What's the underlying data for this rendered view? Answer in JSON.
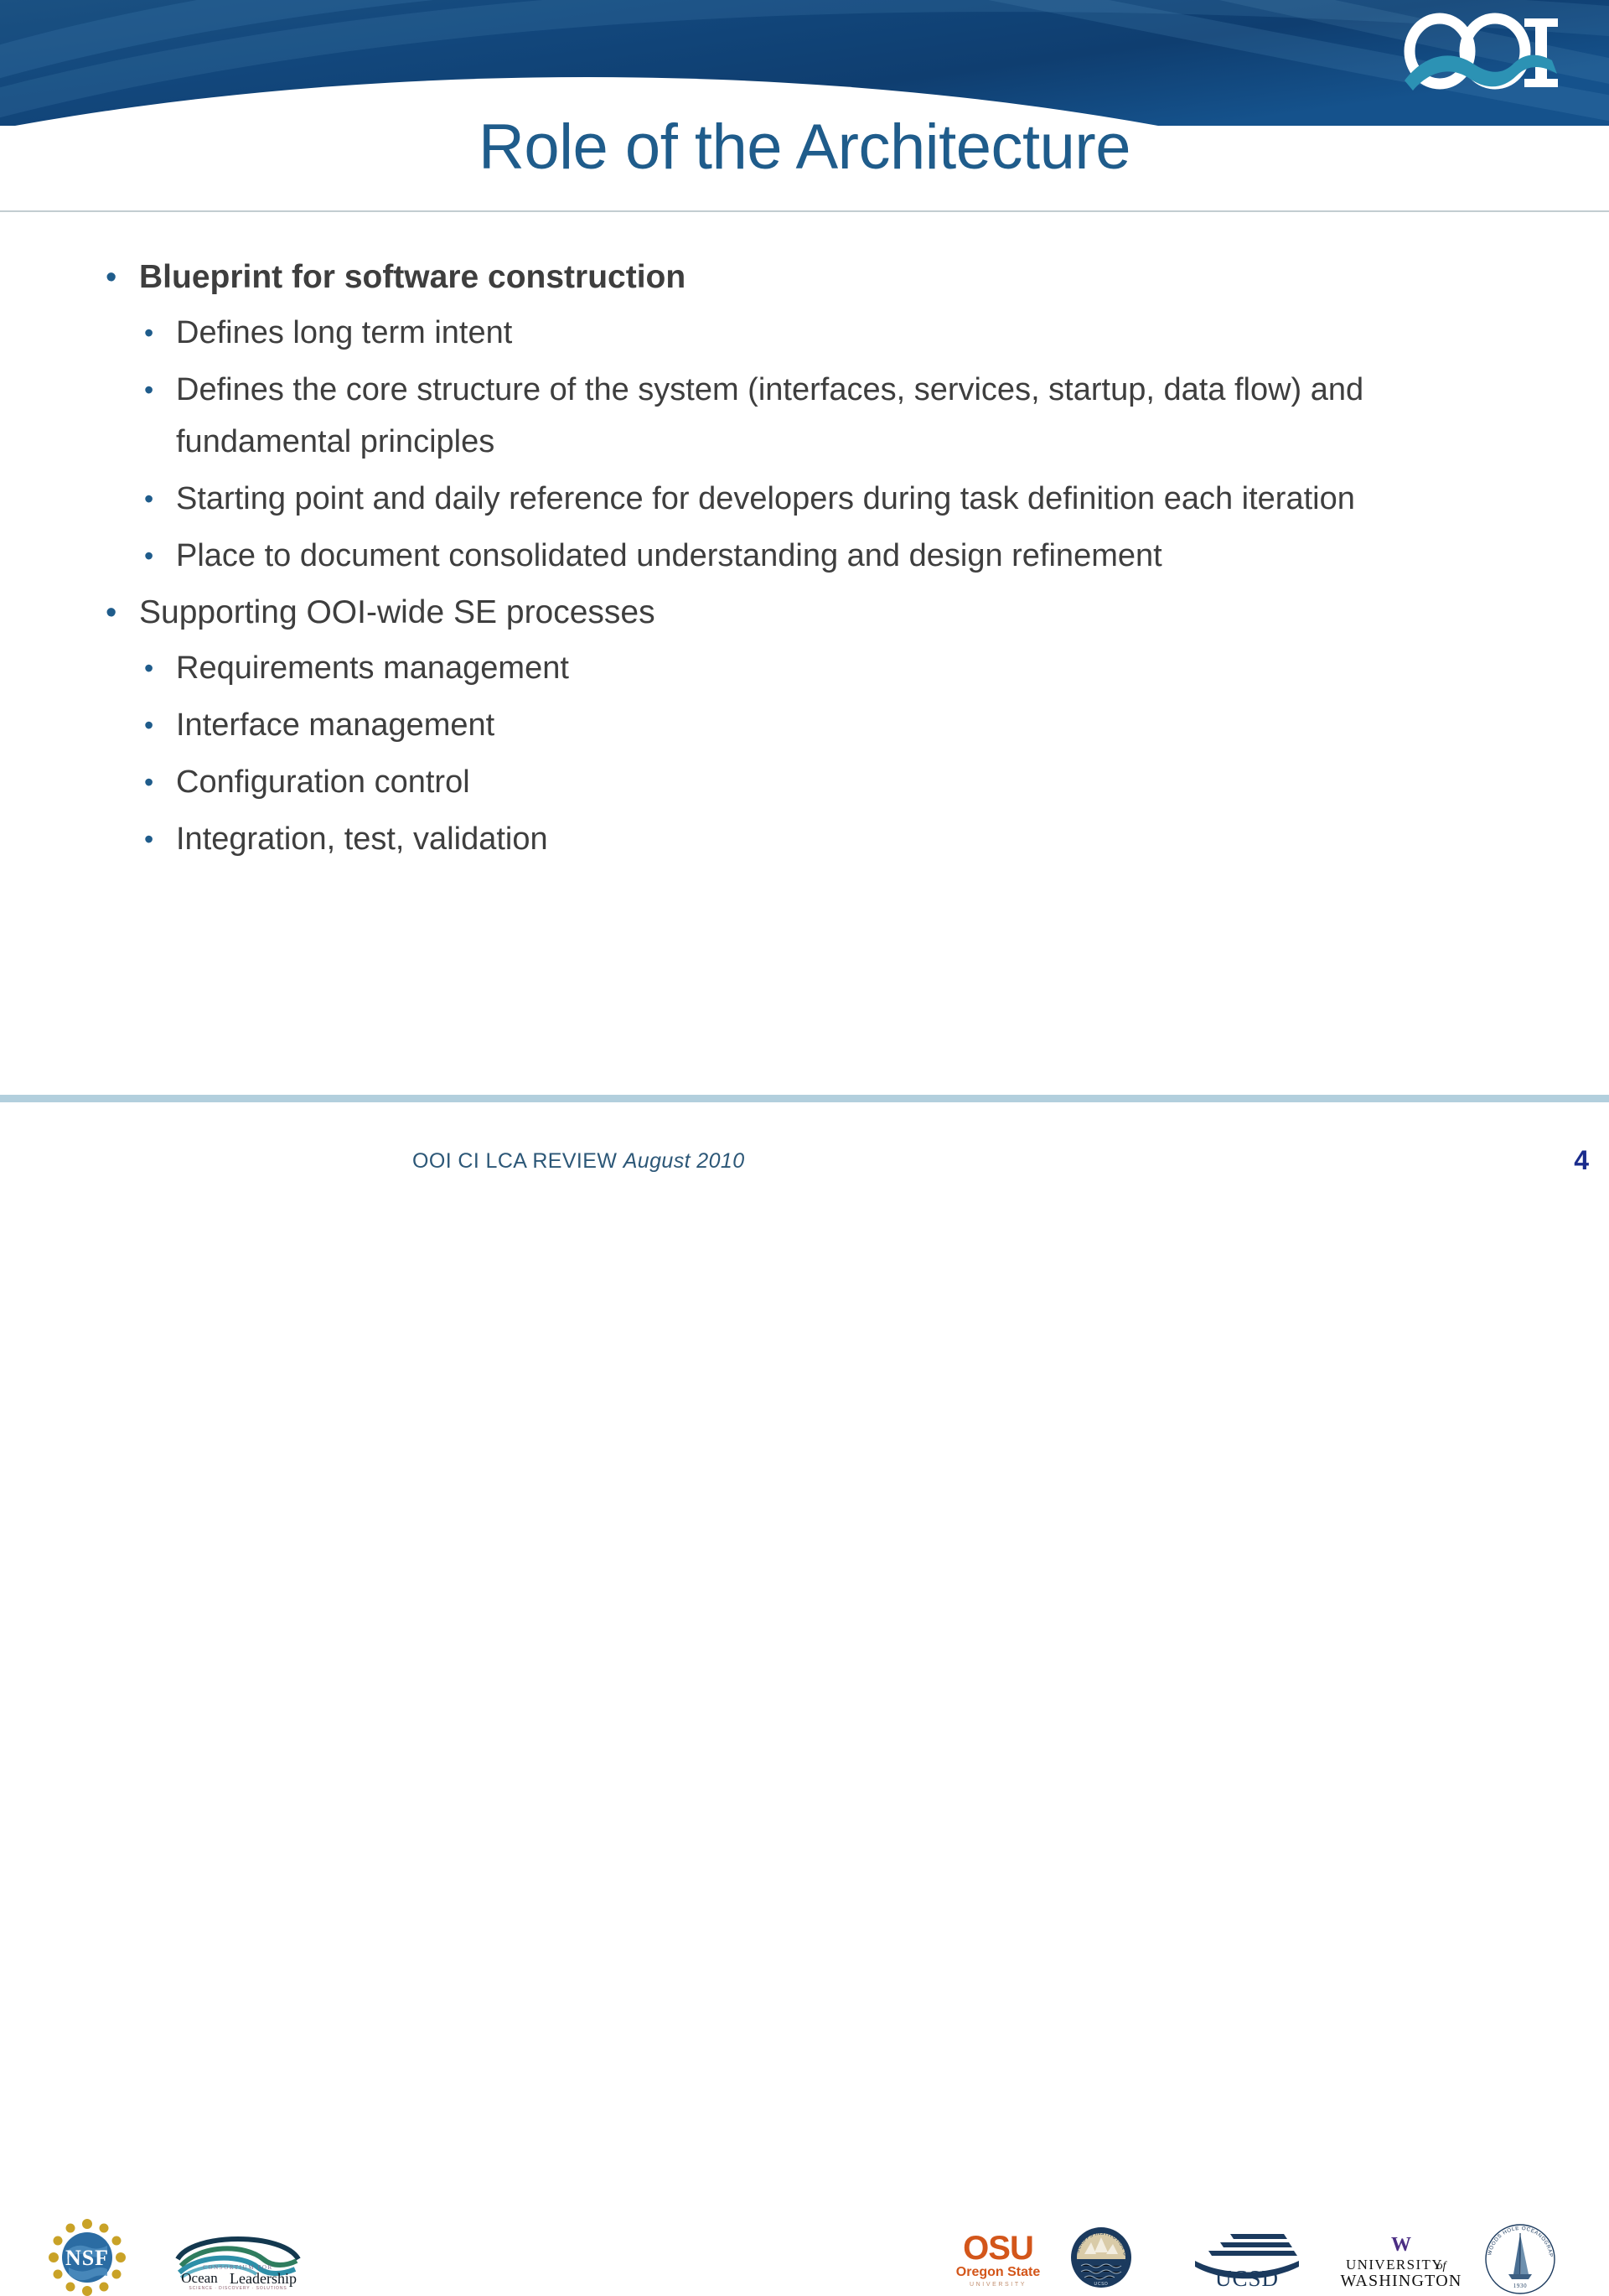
{
  "slide": {
    "title": "Role of the Architecture",
    "title_color": "#1F5C8B",
    "body_text_color": "#3E3E3E",
    "bullet_color": "#1F5C8B",
    "banner_color_dark": "#123E6E",
    "banner_color_light": "#2E6DA0"
  },
  "logo": {
    "name": "OOI",
    "wordmark": "OOI"
  },
  "bullets": [
    {
      "level": 1,
      "bold": true,
      "marker": "•",
      "text": "Blueprint for software construction"
    },
    {
      "level": 2,
      "bold": false,
      "marker": "•",
      "text": "Defines long term intent"
    },
    {
      "level": 2,
      "bold": false,
      "marker": "•",
      "text": "Defines the core structure of the system (interfaces, services, startup, data flow) and fundamental principles"
    },
    {
      "level": 2,
      "bold": false,
      "marker": "•",
      "text": "Starting point and daily reference for developers during task definition each iteration"
    },
    {
      "level": 2,
      "bold": false,
      "marker": "•",
      "text": "Place to document consolidated understanding and design refinement"
    },
    {
      "level": 1,
      "bold": false,
      "marker": "•",
      "text": "Supporting OOI-wide SE processes"
    },
    {
      "level": 2,
      "bold": false,
      "marker": "•",
      "text": "Requirements management"
    },
    {
      "level": 2,
      "bold": false,
      "marker": "•",
      "text": "Interface management"
    },
    {
      "level": 2,
      "bold": false,
      "marker": "•",
      "text": "Configuration control"
    },
    {
      "level": 2,
      "bold": false,
      "marker": "•",
      "text": "Integration, test, validation"
    }
  ],
  "footer": {
    "review_label": "OOI CI LCA REVIEW",
    "date_label": "August 2010",
    "slide_number": "4",
    "logos": [
      {
        "id": "nsf",
        "name": "National Science Foundation",
        "short": "NSF"
      },
      {
        "id": "ol",
        "name": "Consortium for Ocean Leadership",
        "line1": "CONSORTIUM FOR",
        "line2a": "Ocean",
        "line2b": "Leadership",
        "line3": "SCIENCE · DISCOVERY · SOLUTIONS"
      },
      {
        "id": "osu",
        "name": "Oregon State University",
        "short": "OSU",
        "line2": "Oregon State",
        "line3": "UNIVERSITY"
      },
      {
        "id": "sio",
        "name": "Scripps Institution of Oceanography",
        "ring": "SCRIPPS INSTITUTION OF OCEANOGRAPHY",
        "sub": "UCSD"
      },
      {
        "id": "ucsd",
        "name": "UC San Diego",
        "short": "UCSD"
      },
      {
        "id": "uw",
        "name": "University of Washington",
        "mark": "W",
        "line1": "UNIVERSITY",
        "line1b": "of",
        "line2": "WASHINGTON"
      },
      {
        "id": "whoi",
        "name": "Woods Hole Oceanographic Institution",
        "ring": "WOODS HOLE OCEANOGRAPHIC INSTITUTION",
        "year": "1930"
      }
    ]
  }
}
